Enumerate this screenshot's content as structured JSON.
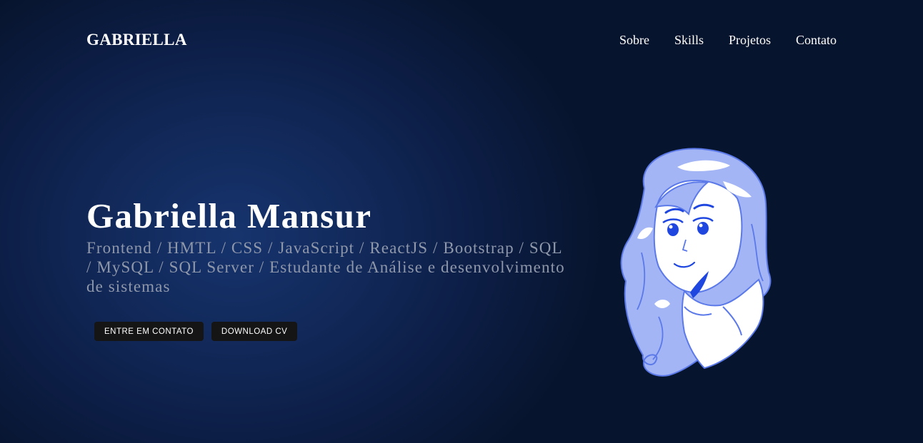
{
  "header": {
    "brand": "GABRIELLA",
    "nav": [
      "Sobre",
      "Skills",
      "Projetos",
      "Contato"
    ]
  },
  "hero": {
    "title": "Gabriella Mansur",
    "subtitle": "Frontend / HMTL / CSS / JavaScript / ReactJS / Bootstrap / SQL / MySQL / SQL Server / Estudante de Análise e desenvolvimento de sistemas",
    "buttons": {
      "contact": "ENTRE EM CONTATO",
      "download_cv": "DOWNLOAD CV"
    }
  },
  "colors": {
    "background": "#0c1d44",
    "avatar_accent": "#a3b5f5",
    "avatar_line": "#1f47e0"
  }
}
